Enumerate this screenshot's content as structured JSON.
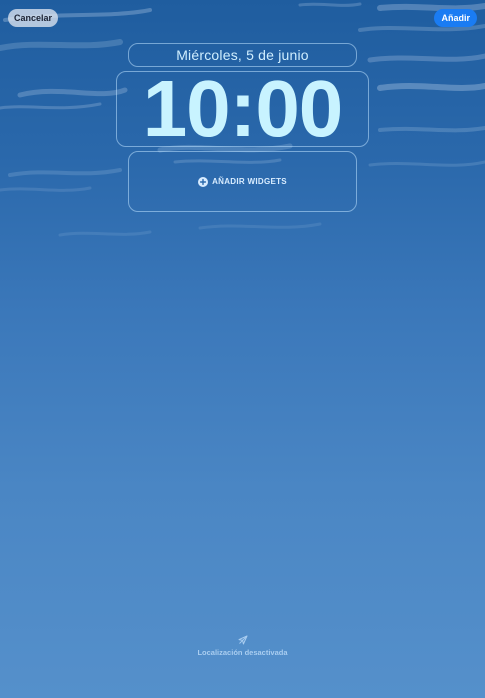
{
  "toolbar": {
    "cancel_label": "Cancelar",
    "add_label": "Añadir"
  },
  "lock_screen": {
    "date": "Miércoles, 5 de junio",
    "time": "10:00",
    "add_widgets_label": "AÑADIR WIDGETS",
    "add_widgets_icon": "plus-circle-icon"
  },
  "footer": {
    "location_icon": "location-arrow-icon",
    "location_status": "Localización desactivada"
  },
  "colors": {
    "accent": "#1a7cf3",
    "clock": "#c8f3ff",
    "sky_top": "#1f5d9f",
    "sky_bottom": "#5590cb"
  }
}
